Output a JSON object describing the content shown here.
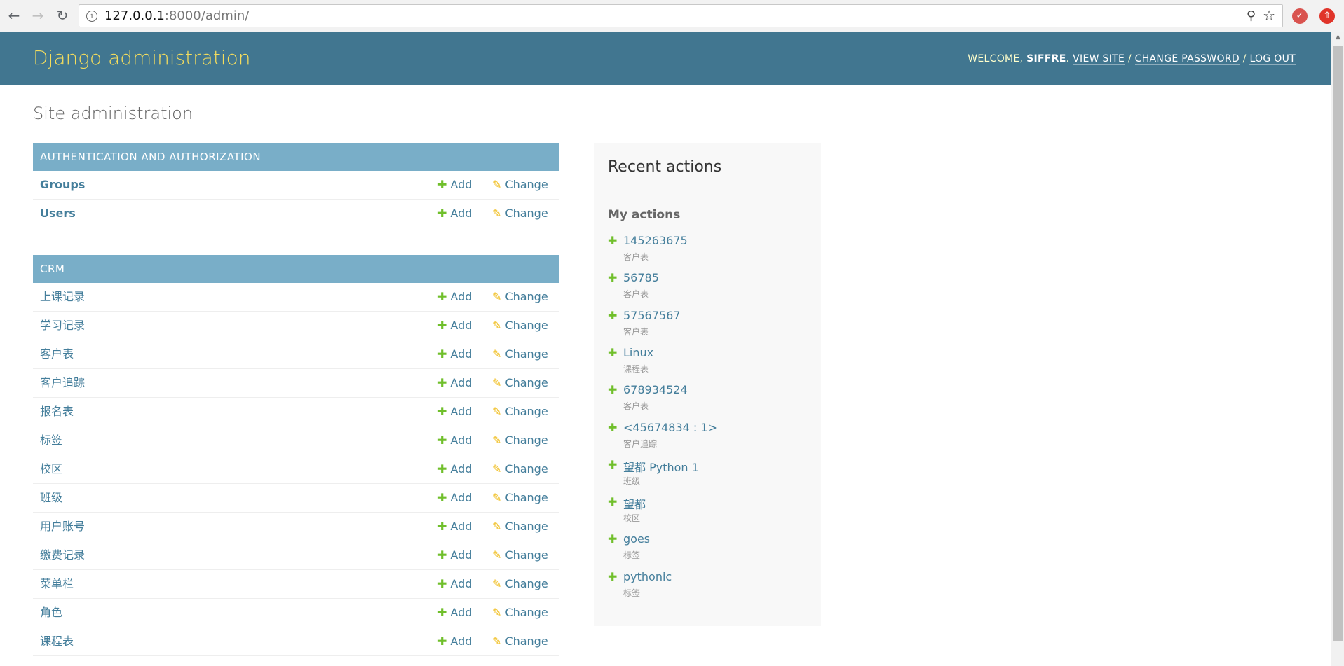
{
  "browser": {
    "url_host": "127.0.0.1",
    "url_path": ":8000/admin/"
  },
  "header": {
    "branding": "Django administration",
    "welcome": "WELCOME, ",
    "username": "SIFFRE",
    "view_site": "VIEW SITE",
    "change_password": "CHANGE PASSWORD",
    "log_out": "LOG OUT",
    "sep": " / "
  },
  "page_title": "Site administration",
  "labels": {
    "add": "Add",
    "change": "Change"
  },
  "modules": [
    {
      "caption": "AUTHENTICATION AND AUTHORIZATION",
      "models": [
        "Groups",
        "Users"
      ]
    },
    {
      "caption": "CRM",
      "models": [
        "上课记录",
        "学习记录",
        "客户表",
        "客户追踪",
        "报名表",
        "标签",
        "校区",
        "班级",
        "用户账号",
        "缴费记录",
        "菜单栏",
        "角色",
        "课程表"
      ]
    }
  ],
  "recent_actions": {
    "title": "Recent actions",
    "subtitle": "My actions",
    "items": [
      {
        "text": "145263675",
        "type": "客户表"
      },
      {
        "text": "56785",
        "type": "客户表"
      },
      {
        "text": "57567567",
        "type": "客户表"
      },
      {
        "text": "Linux",
        "type": "课程表"
      },
      {
        "text": "678934524",
        "type": "客户表"
      },
      {
        "text": "<45674834 : 1>",
        "type": "客户追踪"
      },
      {
        "text": "望都 Python 1",
        "type": "班级"
      },
      {
        "text": "望都",
        "type": "校区"
      },
      {
        "text": "goes",
        "type": "标签"
      },
      {
        "text": "pythonic",
        "type": "标签"
      }
    ]
  },
  "colors": {
    "header_bg": "#417690",
    "branding": "#f5dd5d",
    "caption_bg": "#79aec8",
    "link": "#447e9b",
    "add_green": "#70bf2b",
    "change_yellow": "#efb80b"
  }
}
